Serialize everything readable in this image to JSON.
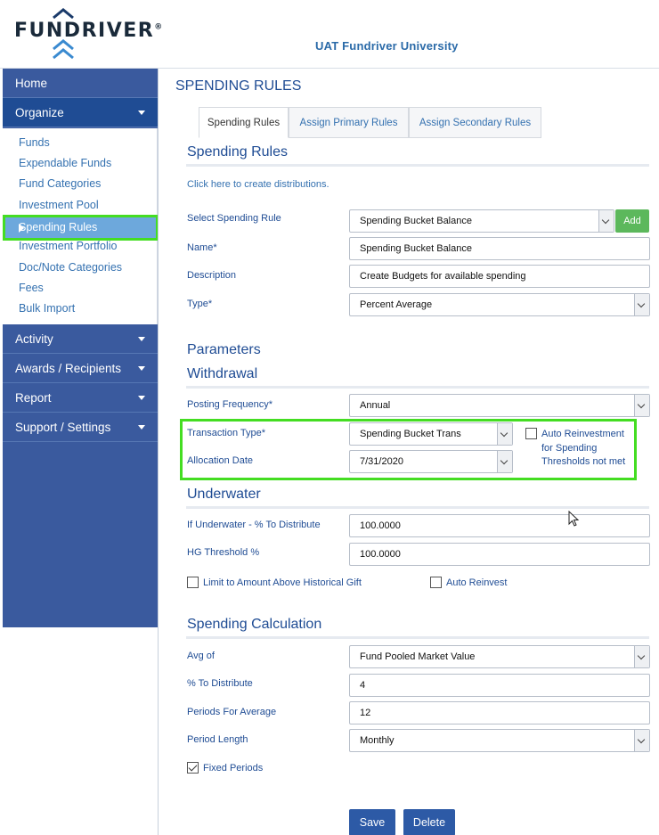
{
  "app": {
    "logo_text": "FUNDRIVER",
    "logo_reg": "®",
    "university": "UAT Fundriver University"
  },
  "sidebar": {
    "home": "Home",
    "organize": "Organize",
    "organize_items": [
      "Funds",
      "Expendable Funds",
      "Fund Categories",
      "Investment Pool",
      "Spending Rules",
      "Investment Portfolio",
      "Doc/Note Categories",
      "Fees",
      "Bulk Import"
    ],
    "activity": "Activity",
    "awards": "Awards / Recipients",
    "report": "Report",
    "support": "Support / Settings"
  },
  "page": {
    "title": "SPENDING RULES",
    "tabs": [
      "Spending Rules",
      "Assign Primary Rules",
      "Assign Secondary Rules"
    ],
    "section_spending_rules": "Spending Rules",
    "create_link": "Click here to create distributions.",
    "select_rule_label": "Select Spending Rule",
    "select_rule_value": "Spending Bucket Balance",
    "add_button": "Add",
    "name_label": "Name*",
    "name_value": "Spending Bucket Balance",
    "description_label": "Description",
    "description_value": "Create Budgets for available spending",
    "type_label": "Type*",
    "type_value": "Percent Average",
    "parameters": "Parameters",
    "withdrawal": "Withdrawal",
    "posting_label": "Posting Frequency*",
    "posting_value": "Annual",
    "transaction_label": "Transaction Type*",
    "transaction_value": "Spending Bucket Trans",
    "auto_reinvest_thresh": [
      "Auto Reinvestment",
      "for Spending",
      "Thresholds not met"
    ],
    "allocation_label": "Allocation Date",
    "allocation_value": "7/31/2020",
    "underwater": "Underwater",
    "uw_pct_label": "If Underwater - % To Distribute",
    "uw_pct_value": "100.0000",
    "hg_label": "HG Threshold %",
    "hg_value": "100.0000",
    "limit_label": "Limit to Amount Above Historical Gift",
    "auto_reinvest_label": "Auto Reinvest",
    "spending_calc": "Spending Calculation",
    "avg_label": "Avg of",
    "avg_value": "Fund Pooled Market Value",
    "dist_label": "% To Distribute",
    "dist_value": "4",
    "periods_label": "Periods For Average",
    "periods_value": "12",
    "length_label": "Period Length",
    "length_value": "Monthly",
    "fixed_label": "Fixed Periods",
    "save": "Save",
    "delete": "Delete"
  },
  "colors": {
    "sidebar": "#3a5a9e",
    "active": "#1f4c94",
    "highlight": "#44dd22",
    "add_button": "#5cb85c",
    "primary_button": "#2d5aa6"
  }
}
